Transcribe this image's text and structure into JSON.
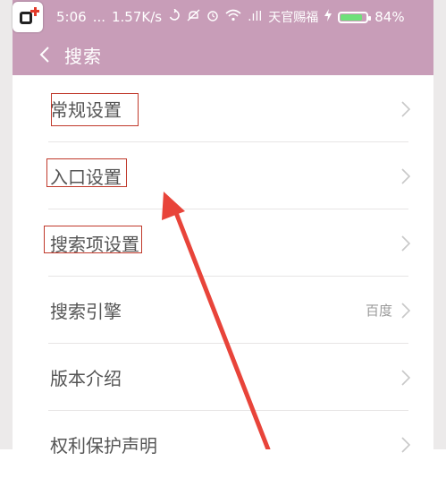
{
  "status_bar": {
    "time": "5:06",
    "dots": "...",
    "speed": "1.57K/s",
    "signal": ".ıll",
    "carrier": "天官赐福",
    "battery_percent": "84%",
    "battery_level": 0.84,
    "battery_color": "#6fe07a"
  },
  "header": {
    "title": "搜索",
    "back_icon": "chevron-left-icon",
    "color": "#c89db8"
  },
  "menu": {
    "items": [
      {
        "label": "常规设置",
        "value": ""
      },
      {
        "label": "入口设置",
        "value": ""
      },
      {
        "label": "搜索项设置",
        "value": ""
      },
      {
        "label": "搜索引擎",
        "value": "百度"
      },
      {
        "label": "版本介绍",
        "value": ""
      },
      {
        "label": "权利保护声明",
        "value": ""
      }
    ]
  },
  "annotations": {
    "highlight_color": "#c0392b",
    "arrow_color": "#e8443a"
  }
}
